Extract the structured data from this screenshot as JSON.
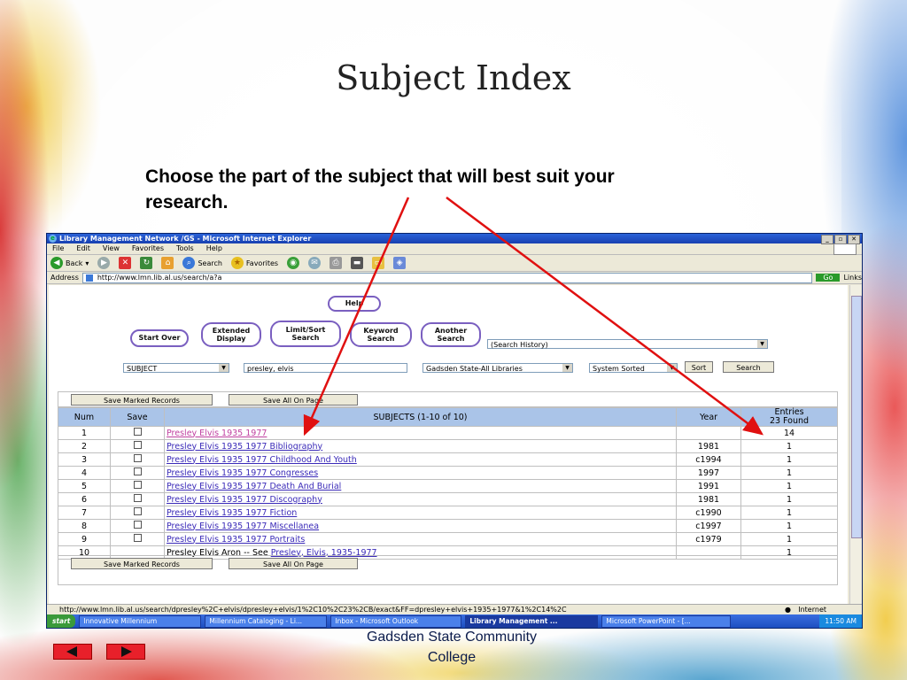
{
  "slide": {
    "title": "Subject Index",
    "body_line1": "Choose the part of the subject that will best suit your",
    "body_line2": "research.",
    "footer_line1": "Gadsden State Community",
    "footer_line2": "College"
  },
  "browser": {
    "window_title": "Library Management Network /GS - Microsoft Internet Explorer",
    "menu": [
      "File",
      "Edit",
      "View",
      "Favorites",
      "Tools",
      "Help"
    ],
    "toolbar": {
      "back": "Back",
      "search": "Search",
      "favorites": "Favorites"
    },
    "address_label": "Address",
    "address_url": "http://www.lmn.lib.al.us/search/a?a",
    "go_label": "Go",
    "links_label": "Links"
  },
  "page": {
    "help_button": "Help",
    "start_over": "Start Over",
    "extended_display_1": "Extended",
    "extended_display_2": "Display",
    "limit_sort_1": "Limit/Sort",
    "limit_sort_2": "Search",
    "keyword_search_1": "Keyword",
    "keyword_search_2": "Search",
    "another_search_1": "Another",
    "another_search_2": "Search",
    "search_history": "(Search History)",
    "search_type": "SUBJECT",
    "search_term": "presley, elvis",
    "scope": "Gadsden State-All Libraries",
    "sort_order": "System Sorted",
    "sort_button": "Sort",
    "search_button": "Search",
    "save_marked": "Save Marked Records",
    "save_all": "Save All On Page"
  },
  "results": {
    "headers": {
      "num": "Num",
      "save": "Save",
      "subjects": "SUBJECTS (1-10 of 10)",
      "year": "Year",
      "entries_1": "Entries",
      "entries_2": "23 Found"
    },
    "rows": [
      {
        "num": "1",
        "subject": "Presley Elvis 1935 1977",
        "year": "",
        "entries": "14"
      },
      {
        "num": "2",
        "subject": "Presley Elvis 1935 1977 Bibliography",
        "year": "1981",
        "entries": "1"
      },
      {
        "num": "3",
        "subject": "Presley Elvis 1935 1977 Childhood And Youth",
        "year": "c1994",
        "entries": "1"
      },
      {
        "num": "4",
        "subject": "Presley Elvis 1935 1977 Congresses",
        "year": "1997",
        "entries": "1"
      },
      {
        "num": "5",
        "subject": "Presley Elvis 1935 1977 Death And Burial",
        "year": "1991",
        "entries": "1"
      },
      {
        "num": "6",
        "subject": "Presley Elvis 1935 1977 Discography",
        "year": "1981",
        "entries": "1"
      },
      {
        "num": "7",
        "subject": "Presley Elvis 1935 1977 Fiction",
        "year": "c1990",
        "entries": "1"
      },
      {
        "num": "8",
        "subject": "Presley Elvis 1935 1977 Miscellanea",
        "year": "c1997",
        "entries": "1"
      },
      {
        "num": "9",
        "subject": "Presley Elvis 1935 1977 Portraits",
        "year": "c1979",
        "entries": "1"
      },
      {
        "num": "10",
        "subject_prefix": "Presley Elvis Aron -- See ",
        "subject": "Presley, Elvis, 1935-1977",
        "year": "",
        "entries": "1"
      }
    ]
  },
  "statusbar": {
    "url": "http://www.lmn.lib.al.us/search/dpresley%2C+elvis/dpresley+elvis/1%2C10%2C23%2CB/exact&FF=dpresley+elvis+1935+1977&1%2C14%2C",
    "zone": "Internet"
  },
  "taskbar": {
    "start": "start",
    "tasks": [
      "Innovative Millennium",
      "Millennium Cataloging - Li...",
      "Inbox - Microsoft Outlook",
      "Library Management ...",
      "Microsoft PowerPoint - [..."
    ],
    "clock": "11:50 AM"
  },
  "colors": {
    "arrow": "#e01010",
    "header_bg": "#aac4e8",
    "link": "#3a2ab8"
  }
}
